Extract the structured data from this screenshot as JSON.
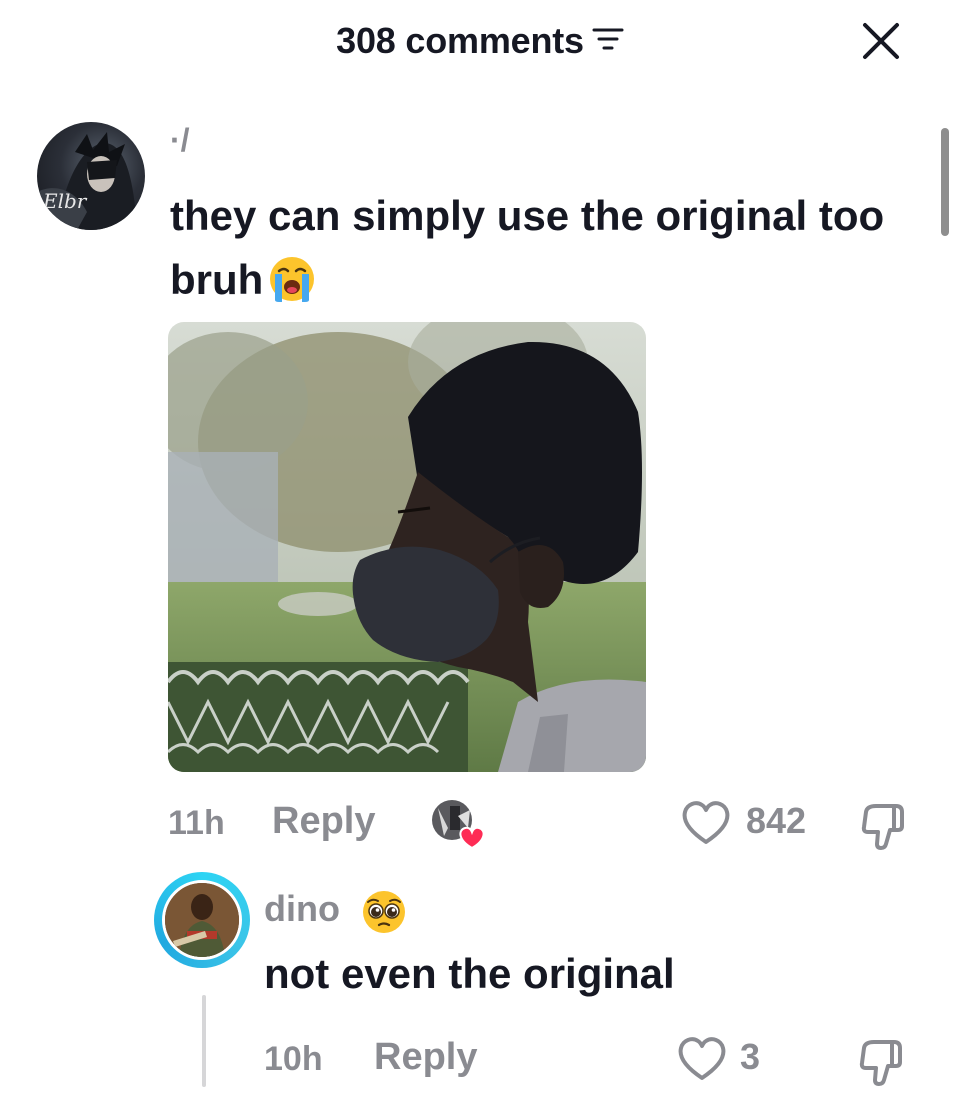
{
  "header": {
    "comment_count": "308 comments",
    "filter_icon": "filter-icon",
    "close_icon": "close-icon"
  },
  "comment": {
    "username": "·/",
    "text": "they can simply use the original too bruh",
    "text_emoji": "loudly-crying-face-emoji",
    "image": "photo-of-boy-wearing-black-face-mask-in-profile",
    "time": "11h",
    "reply_label": "Reply",
    "liked_by_creator_icon": "creator-liked-heart-icon",
    "like_count": "842"
  },
  "reply": {
    "username": "dino",
    "username_emoji": "pleading-face-emoji",
    "text": "not even the original",
    "time": "10h",
    "reply_label": "Reply",
    "like_count": "3"
  },
  "colors": {
    "text_primary": "#161823",
    "text_secondary": "#8a8b91",
    "story_ring": "#2dd4f4",
    "like_heart": "#fe2c55"
  }
}
